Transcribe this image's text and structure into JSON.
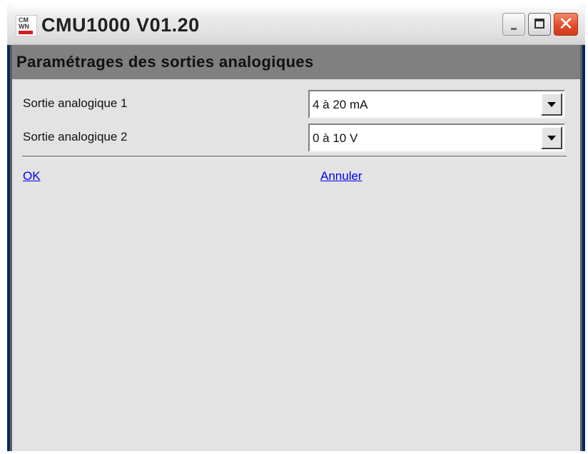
{
  "window": {
    "title": "CMU1000 V01.20",
    "app_icon_top": "CM",
    "app_icon_bottom": "WN"
  },
  "section": {
    "title": "Paramétrages des sorties analogiques"
  },
  "fields": [
    {
      "label": "Sortie analogique 1",
      "value": "4 à 20 mA"
    },
    {
      "label": "Sortie analogique 2",
      "value": "0 à 10 V"
    }
  ],
  "actions": {
    "ok": "OK",
    "cancel": "Annuler"
  },
  "colors": {
    "section_bg": "#808080",
    "client_bg": "#e3e3e3",
    "link": "#0000ee",
    "close_button": "#e0492a"
  }
}
